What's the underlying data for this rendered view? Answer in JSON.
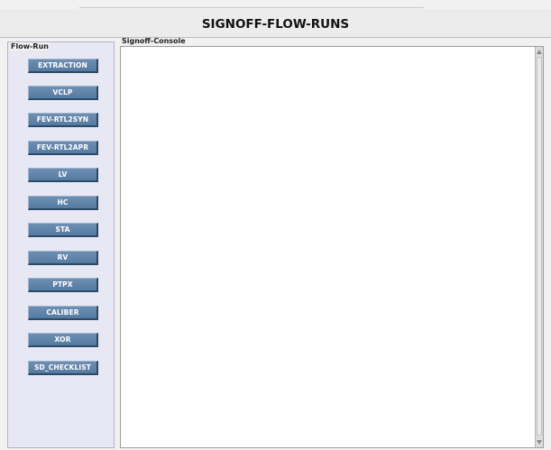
{
  "window": {
    "title": "SIGNOFF-FLOW-RUNS"
  },
  "flow_run": {
    "legend": "Flow-Run",
    "buttons": [
      {
        "label": "EXTRACTION"
      },
      {
        "label": "VCLP"
      },
      {
        "label": "FEV-RTL2SYN"
      },
      {
        "label": "FEV-RTL2APR"
      },
      {
        "label": "LV"
      },
      {
        "label": "HC"
      },
      {
        "label": "STA"
      },
      {
        "label": "RV"
      },
      {
        "label": "PTPX"
      },
      {
        "label": "CALIBER"
      },
      {
        "label": "XOR"
      },
      {
        "label": "SD_CHECKLIST"
      }
    ]
  },
  "console": {
    "label": "Signoff-Console",
    "text": ""
  },
  "colors": {
    "button_fill": "#5f85ad",
    "button_text": "#ffffff",
    "panel_background": "#e8e8f4",
    "console_background": "#ffffff"
  },
  "icons": {
    "scroll_up": "triangle-up",
    "scroll_down": "triangle-down"
  }
}
